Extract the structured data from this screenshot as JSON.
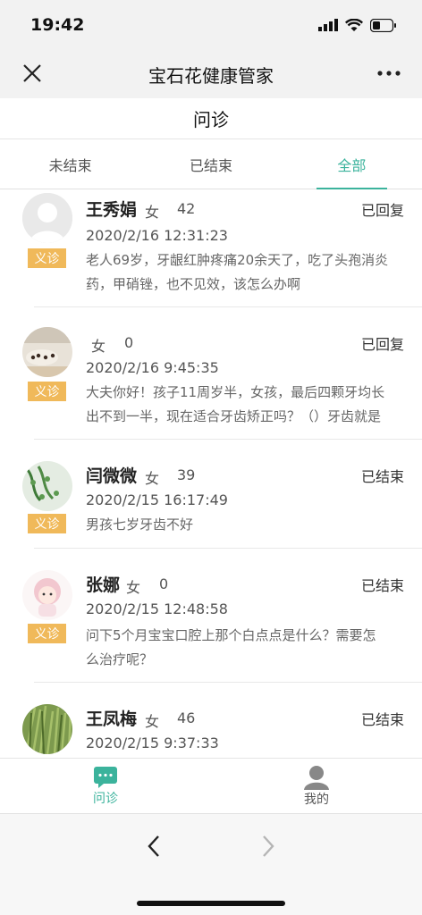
{
  "statusbar": {
    "time": "19:42"
  },
  "navbar": {
    "title": "宝石花健康管家"
  },
  "page": {
    "title": "问诊"
  },
  "tabs": [
    {
      "label": "未结束",
      "active": false
    },
    {
      "label": "已结束",
      "active": false
    },
    {
      "label": "全部",
      "active": true
    }
  ],
  "consultations": [
    {
      "name": "王秀娟",
      "gender": "女",
      "age": "42",
      "status": "已回复",
      "tag": "义诊",
      "time": "2020/2/16 12:31:23",
      "desc_line1": "老人69岁，牙龈红肿疼痛20余天了，吃了头孢消炎",
      "desc_line2": "药，甲硝锉，也不见效，该怎么办啊"
    },
    {
      "name": "",
      "gender": "女",
      "age": "0",
      "status": "已回复",
      "tag": "义诊",
      "time": "2020/2/16 9:45:35",
      "desc_line1": "大夫你好！孩子11周岁半，女孩，最后四颗牙均长",
      "desc_line2": "出不到一半，现在适合牙齿矫正吗？（）牙齿就是"
    },
    {
      "name": "闫微微",
      "gender": "女",
      "age": "39",
      "status": "已结束",
      "tag": "义诊",
      "time": "2020/2/15 16:17:49",
      "desc_line1": "男孩七岁牙齿不好",
      "desc_line2": ""
    },
    {
      "name": "张娜",
      "gender": "女",
      "age": "0",
      "status": "已结束",
      "tag": "义诊",
      "time": "2020/2/15 12:48:58",
      "desc_line1": "问下5个月宝宝口腔上那个白点点是什么？需要怎",
      "desc_line2": "么治疗呢？"
    },
    {
      "name": "王凤梅",
      "gender": "女",
      "age": "46",
      "status": "已结束",
      "tag": "",
      "time": "2020/2/15 9:37:33",
      "desc_line1": "",
      "desc_line2": ""
    }
  ],
  "bottom_nav": {
    "consult_label": "问诊",
    "mine_label": "我的"
  },
  "colors": {
    "accent": "#3bb39c",
    "tag": "#f0b95a"
  }
}
